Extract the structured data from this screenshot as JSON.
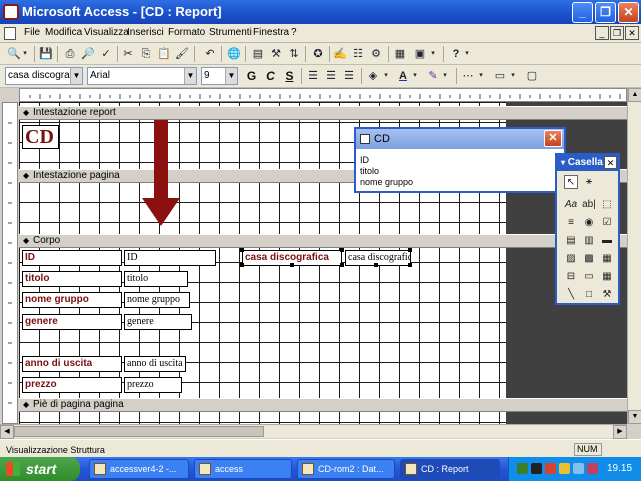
{
  "window": {
    "title": "Microsoft Access - [CD : Report]"
  },
  "menu": [
    "File",
    "Modifica",
    "Visualizza",
    "Inserisci",
    "Formato",
    "Strumenti",
    "Finestra",
    "?"
  ],
  "format_toolbar": {
    "object_combo": "casa discografic",
    "font_combo": "Arial",
    "size_combo": "9"
  },
  "sections": {
    "report_header": "Intestazione report",
    "page_header": "Intestazione pagina",
    "detail": "Corpo",
    "page_footer": "Piè di pagina pagina"
  },
  "report_title": "CD",
  "fields": [
    {
      "label": "ID",
      "box": "ID"
    },
    {
      "label": "titolo",
      "box": "titolo"
    },
    {
      "label": "nome gruppo",
      "box": "nome gruppo"
    },
    {
      "label": "genere",
      "box": "genere"
    },
    {
      "label": "anno di uscita",
      "box": "anno di uscita"
    },
    {
      "label": "prezzo",
      "box": "prezzo"
    }
  ],
  "selected_field": {
    "label": "casa discografica",
    "box": "casa discografica"
  },
  "field_list": {
    "title": "CD",
    "items": [
      "ID",
      "titolo",
      "nome gruppo"
    ]
  },
  "toolbox": {
    "title": "Casella"
  },
  "status": {
    "text": "Visualizzazione Struttura",
    "num": "NUM"
  },
  "taskbar": {
    "start": "start",
    "tasks": [
      "accessver4-2 -...",
      "access",
      "CD-rom2 : Dat...",
      "CD : Report"
    ],
    "clock": "19.15"
  },
  "colors": {
    "label_text": "#7a1010",
    "arrow": "#8b1010",
    "title_bar": "#1a4fc9"
  }
}
